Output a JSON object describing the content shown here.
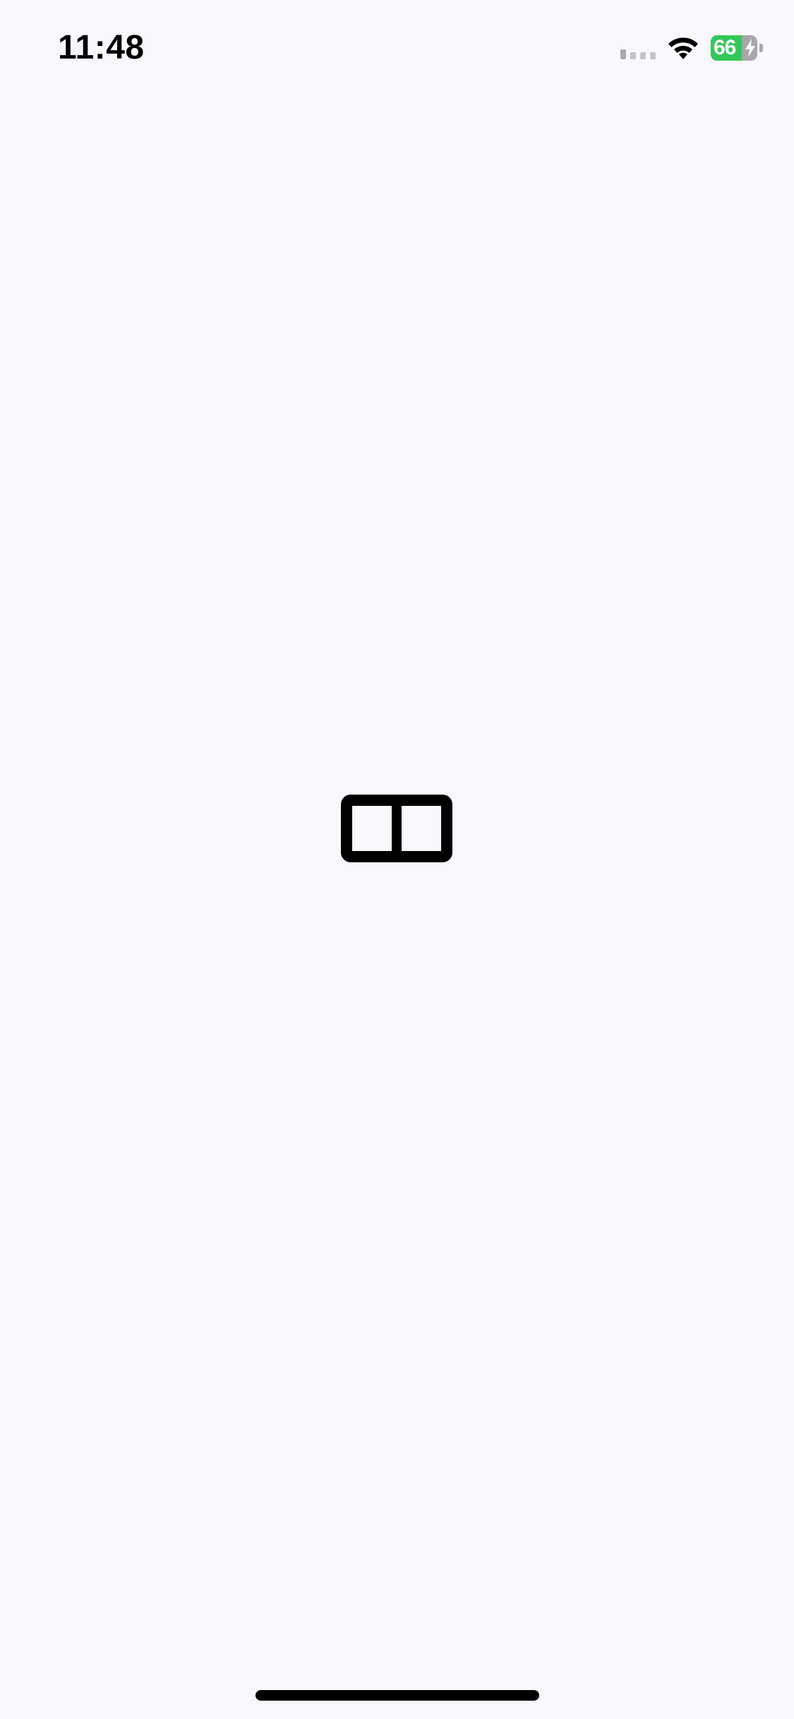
{
  "status_bar": {
    "time": "11:48",
    "battery_percent": 66,
    "battery_text": "66",
    "signal_icon": "cellular-signal-icon",
    "wifi_icon": "wifi-icon",
    "charging_icon": "bolt-icon"
  },
  "content": {
    "center_icon": "split-view-icon"
  },
  "colors": {
    "background": "#f9f8fd",
    "battery_fill": "#34c759",
    "battery_empty": "#a7a7ab",
    "icon": "#000000"
  }
}
